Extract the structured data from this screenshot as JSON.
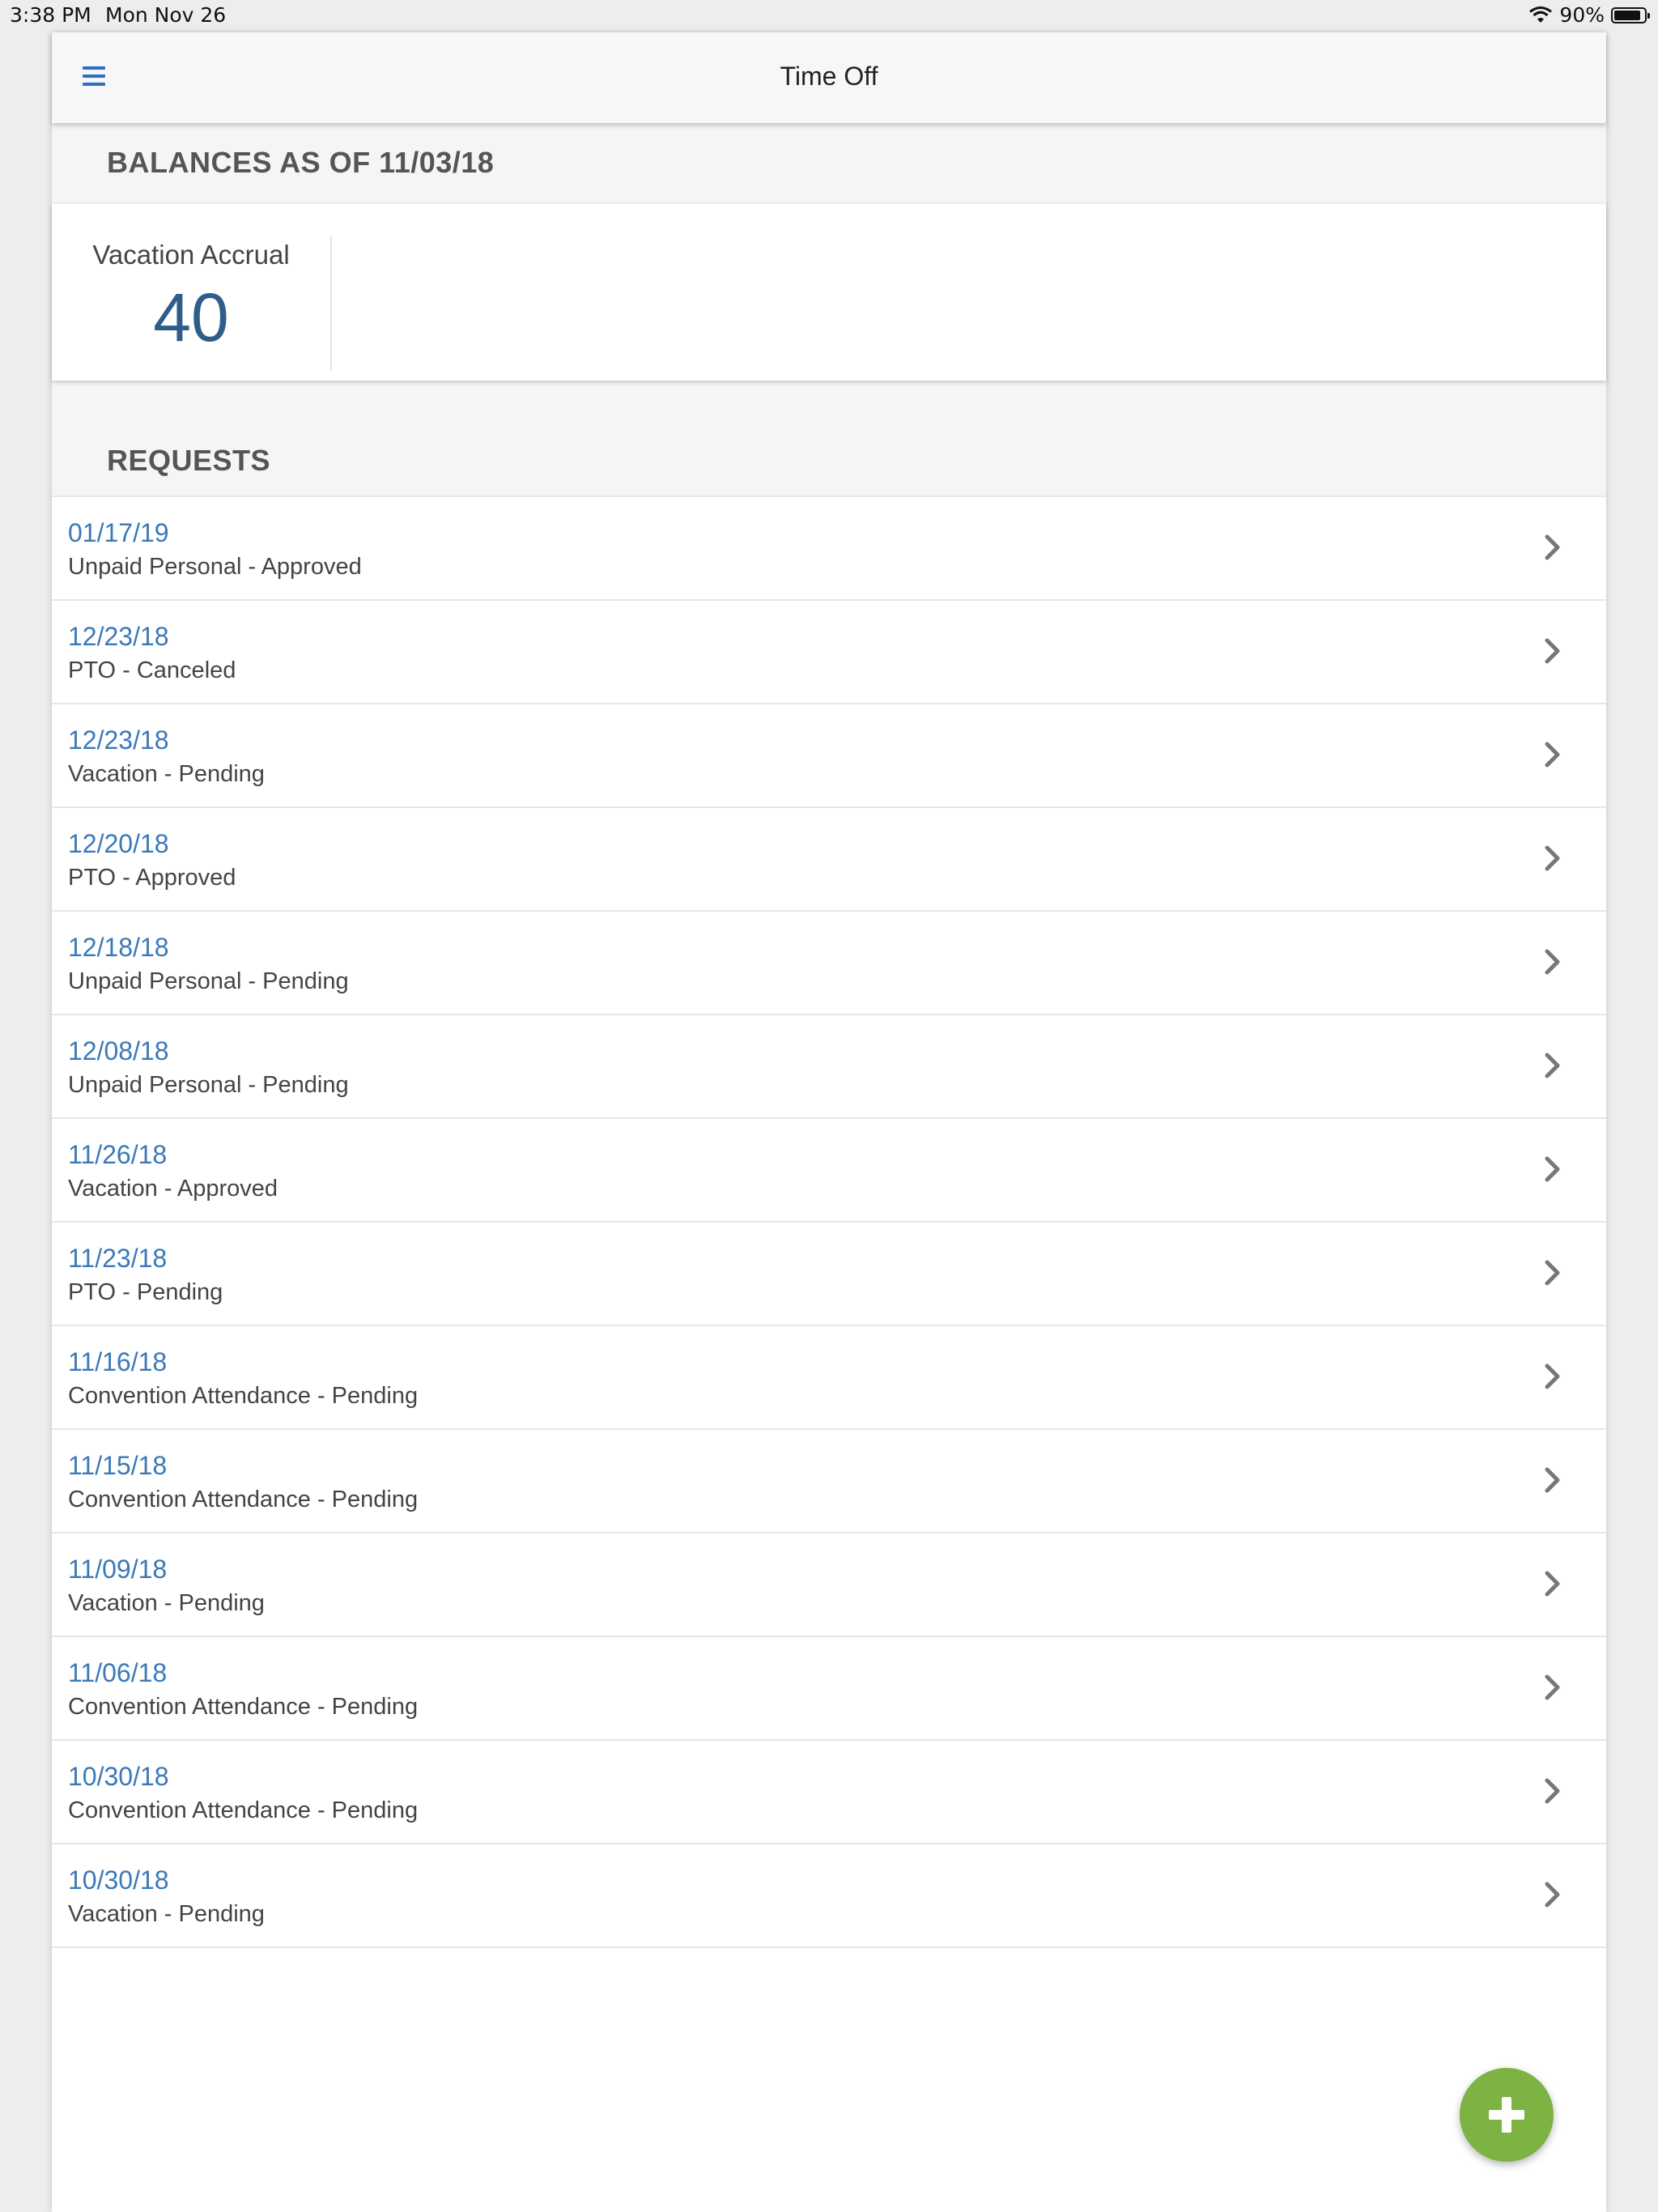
{
  "status_bar": {
    "time": "3:38 PM",
    "date": "Mon Nov 26",
    "battery": "90%"
  },
  "navbar": {
    "title": "Time Off",
    "menu_icon": "hamburger-menu-icon"
  },
  "balances": {
    "header": "BALANCES AS OF 11/03/18",
    "items": [
      {
        "label": "Vacation Accrual",
        "value": "40"
      }
    ]
  },
  "requests": {
    "header": "REQUESTS",
    "items": [
      {
        "date": "01/17/19",
        "desc": "Unpaid Personal - Approved"
      },
      {
        "date": "12/23/18",
        "desc": "PTO - Canceled"
      },
      {
        "date": "12/23/18",
        "desc": "Vacation - Pending"
      },
      {
        "date": "12/20/18",
        "desc": "PTO - Approved"
      },
      {
        "date": "12/18/18",
        "desc": "Unpaid Personal - Pending"
      },
      {
        "date": "12/08/18",
        "desc": "Unpaid Personal - Pending"
      },
      {
        "date": "11/26/18",
        "desc": "Vacation - Approved"
      },
      {
        "date": "11/23/18",
        "desc": "PTO - Pending"
      },
      {
        "date": "11/16/18",
        "desc": "Convention Attendance - Pending"
      },
      {
        "date": "11/15/18",
        "desc": "Convention Attendance - Pending"
      },
      {
        "date": "11/09/18",
        "desc": "Vacation - Pending"
      },
      {
        "date": "11/06/18",
        "desc": "Convention Attendance - Pending"
      },
      {
        "date": "10/30/18",
        "desc": "Convention Attendance - Pending"
      },
      {
        "date": "10/30/18",
        "desc": "Vacation - Pending"
      }
    ]
  },
  "fab": {
    "icon": "plus-icon"
  },
  "colors": {
    "accent_blue": "#3a79b8",
    "menu_blue": "#2f6fc4",
    "fab_green": "#7cb342",
    "balance_value": "#2f5d8a"
  }
}
